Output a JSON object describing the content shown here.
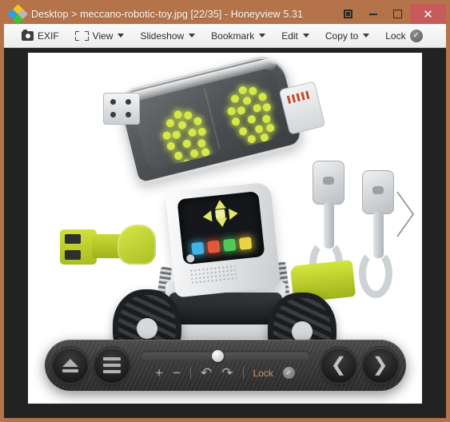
{
  "window": {
    "title": "Desktop > meccano-robotic-toy.jpg [22/35] - Honeyview 5.31",
    "app_icon": "honeyview-diamond-icon",
    "controls": {
      "restore_icon": "restore-window-icon",
      "minimize_icon": "minimize-icon",
      "maximize_icon": "maximize-icon",
      "close_label": "✕"
    },
    "frame_color": "#b5734a",
    "close_button_color": "#c75a5a"
  },
  "toolbar": {
    "items": [
      {
        "label": "EXIF",
        "icon": "camera-icon",
        "has_caret": false
      },
      {
        "label": "View",
        "icon": "crop-frame-icon",
        "has_caret": true
      },
      {
        "label": "Slideshow",
        "icon": "",
        "has_caret": true
      },
      {
        "label": "Bookmark",
        "icon": "",
        "has_caret": true
      },
      {
        "label": "Edit",
        "icon": "",
        "has_caret": true
      },
      {
        "label": "Copy to",
        "icon": "",
        "has_caret": true
      },
      {
        "label": "Lock",
        "icon": "check-circle-icon",
        "has_caret": false
      }
    ]
  },
  "viewer": {
    "background": "#222222",
    "image_background": "#ffffff",
    "next_overlay_icon": "chevron-right-overlay-icon",
    "photo": {
      "subject": "meccano robotic toy",
      "head": {
        "eyes": "led-dot-eyes",
        "led_color": "#d7e84a"
      },
      "chest_panel": {
        "dpad_color": "#e3e86a",
        "buttons": [
          "#3bb5e8",
          "#e8553b",
          "#4fc85a",
          "#ecd245"
        ]
      },
      "accent_color": "#cfe03a",
      "wheels": 2
    }
  },
  "control_bar": {
    "eject_icon": "eject-icon",
    "menu_icon": "hamburger-menu-icon",
    "slider": {
      "value_percent": 42
    },
    "zoom_in": "+",
    "zoom_out": "−",
    "rotate_left_icon": "rotate-counterclockwise-icon",
    "rotate_right_icon": "rotate-clockwise-icon",
    "lock_label": "Lock",
    "lock_check_icon": "check-circle-icon",
    "prev_icon": "chevron-left-icon",
    "next_icon": "chevron-right-icon"
  }
}
